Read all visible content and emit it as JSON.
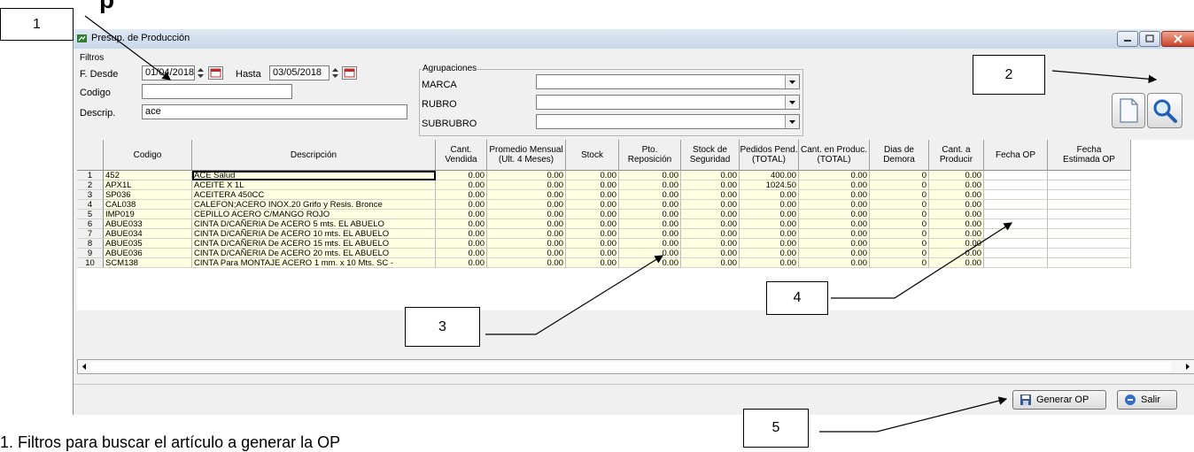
{
  "page_heading": "p",
  "window": {
    "title": "Presup. de Producción"
  },
  "filters": {
    "legend": "Filtros",
    "from_label": "F. Desde",
    "from_value": "01/04/2018",
    "to_label": "Hasta",
    "to_value": "03/05/2018",
    "code_label": "Codigo",
    "code_value": "",
    "desc_label": "Descrip.",
    "desc_value": "ace"
  },
  "groupings": {
    "legend": "Agrupaciones",
    "items": [
      {
        "label": "MARCA",
        "value": ""
      },
      {
        "label": "RUBRO",
        "value": ""
      },
      {
        "label": "SUBRUBRO",
        "value": ""
      }
    ]
  },
  "table": {
    "columns": [
      {
        "label": "Codigo"
      },
      {
        "label": "Descripción"
      },
      {
        "label": "Cant.\nVendida"
      },
      {
        "label": "Promedio Mensual\n(Ult. 4 Meses)"
      },
      {
        "label": "Stock"
      },
      {
        "label": "Pto.\nReposición"
      },
      {
        "label": "Stock de\nSeguridad"
      },
      {
        "label": "Pedidos Pend.\n(TOTAL)"
      },
      {
        "label": "Cant. en Produc.\n(TOTAL)"
      },
      {
        "label": "Dias de\nDemora"
      },
      {
        "label": "Cant. a\nProducir"
      },
      {
        "label": "Fecha OP"
      },
      {
        "label": "Fecha\nEstimada OP"
      }
    ],
    "rows": [
      {
        "n": "1",
        "code": "452",
        "desc": "ACE Salud",
        "vals": [
          "0.00",
          "0.00",
          "0.00",
          "0.00",
          "0.00",
          "400.00",
          "0.00",
          "0",
          "0.00"
        ]
      },
      {
        "n": "2",
        "code": "APX1L",
        "desc": "ACEITE X 1L",
        "vals": [
          "0.00",
          "0.00",
          "0.00",
          "0.00",
          "0.00",
          "1024.50",
          "0.00",
          "0",
          "0.00"
        ]
      },
      {
        "n": "3",
        "code": "SP036",
        "desc": "ACEITERA 450CC",
        "vals": [
          "0.00",
          "0.00",
          "0.00",
          "0.00",
          "0.00",
          "0.00",
          "0.00",
          "0",
          "0.00"
        ]
      },
      {
        "n": "4",
        "code": "CAL038",
        "desc": "CALEFON;ACERO INOX.20 Grifo y Resis.  Bronce",
        "vals": [
          "0.00",
          "0.00",
          "0.00",
          "0.00",
          "0.00",
          "0.00",
          "0.00",
          "0",
          "0.00"
        ]
      },
      {
        "n": "5",
        "code": "IMP019",
        "desc": "CEPILLO ACERO C/MANGO ROJO",
        "vals": [
          "0.00",
          "0.00",
          "0.00",
          "0.00",
          "0.00",
          "0.00",
          "0.00",
          "0",
          "0.00"
        ]
      },
      {
        "n": "6",
        "code": "ABUE033",
        "desc": "CINTA D/CAÑERIA De ACERO  5 mts.  EL ABUELO",
        "vals": [
          "0.00",
          "0.00",
          "0.00",
          "0.00",
          "0.00",
          "0.00",
          "0.00",
          "0",
          "0.00"
        ]
      },
      {
        "n": "7",
        "code": "ABUE034",
        "desc": "CINTA D/CAÑERIA De ACERO 10 mts.  EL ABUELO",
        "vals": [
          "0.00",
          "0.00",
          "0.00",
          "0.00",
          "0.00",
          "0.00",
          "0.00",
          "0",
          "0.00"
        ]
      },
      {
        "n": "8",
        "code": "ABUE035",
        "desc": "CINTA D/CAÑERIA De ACERO 15 mts.  EL ABUELO",
        "vals": [
          "0.00",
          "0.00",
          "0.00",
          "0.00",
          "0.00",
          "0.00",
          "0.00",
          "0",
          "0.00"
        ]
      },
      {
        "n": "9",
        "code": "ABUE036",
        "desc": "CINTA D/CAÑERIA De ACERO 20 mts.  EL ABUELO",
        "vals": [
          "0.00",
          "0.00",
          "0.00",
          "0.00",
          "0.00",
          "0.00",
          "0.00",
          "0",
          "0.00"
        ]
      },
      {
        "n": "10",
        "code": "SCM138",
        "desc": "CINTA Para MONTAJE ACERO 1 mm. x 10 Mts. SC -",
        "vals": [
          "0.00",
          "0.00",
          "0.00",
          "0.00",
          "0.00",
          "0.00",
          "0.00",
          "0",
          "0.00"
        ]
      }
    ]
  },
  "buttons": {
    "generate": "Generar OP",
    "exit": "Salir"
  },
  "callouts": [
    "1",
    "2",
    "3",
    "4",
    "5"
  ],
  "footer_text": "1.   Filtros para buscar el artículo a generar la OP",
  "colors": {
    "grid_fill": "#ffffe1",
    "accent": "#1f5fb4"
  }
}
